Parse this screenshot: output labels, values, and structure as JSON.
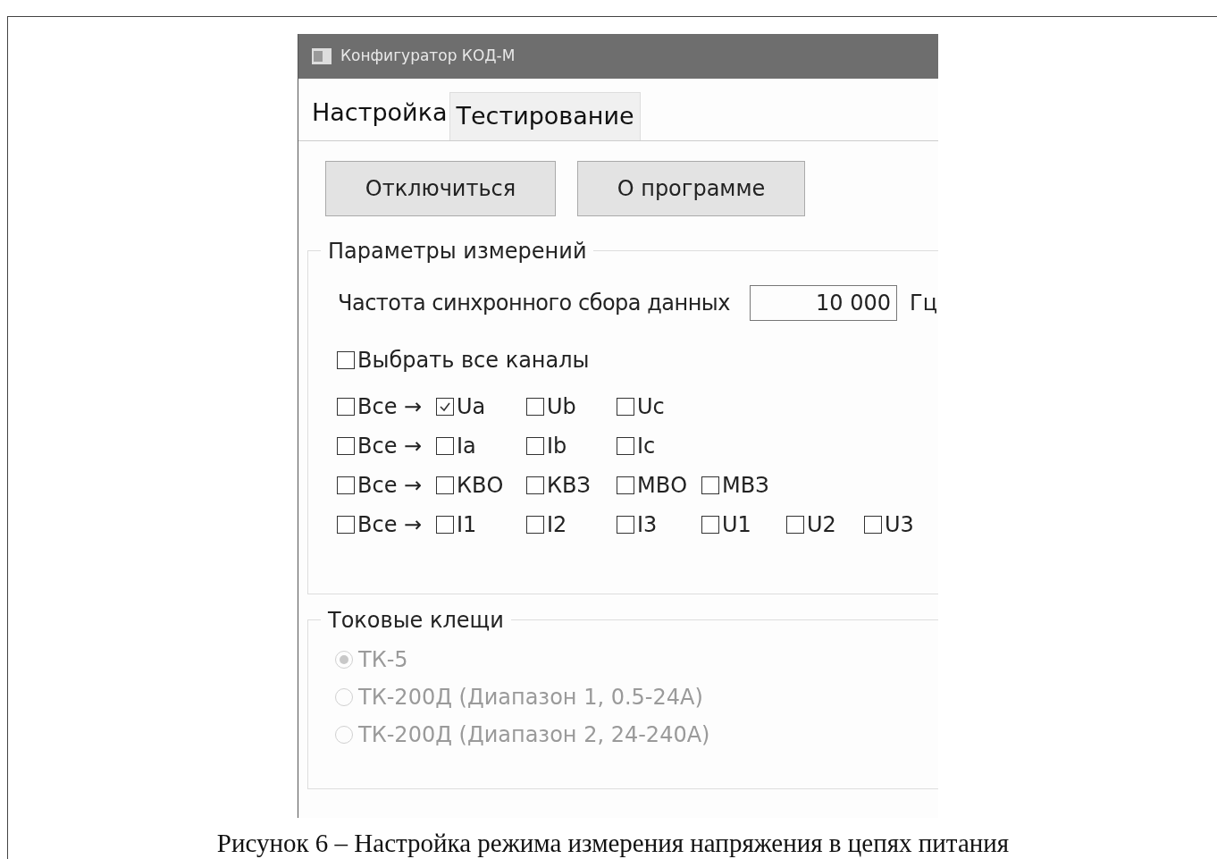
{
  "window": {
    "title": "Конфигуратор КОД-М"
  },
  "tabs": [
    {
      "label": "Настройка",
      "selected": true
    },
    {
      "label": "Тестирование",
      "selected": false
    }
  ],
  "buttons": [
    "Отключиться",
    "О программе"
  ],
  "measurement": {
    "title": "Параметры измерений",
    "frequency_label": "Частота синхронного сбора данных",
    "frequency_value": "10 000",
    "frequency_unit": "Гц",
    "select_all": {
      "label": "Выбрать все каналы",
      "checked": false
    },
    "rows": [
      {
        "all": {
          "label": "Все →",
          "checked": false
        },
        "channels": [
          {
            "label": "Ua",
            "checked": true
          },
          {
            "label": "Ub",
            "checked": false
          },
          {
            "label": "Uc",
            "checked": false
          }
        ]
      },
      {
        "all": {
          "label": "Все →",
          "checked": false
        },
        "channels": [
          {
            "label": "Ia",
            "checked": false
          },
          {
            "label": "Ib",
            "checked": false
          },
          {
            "label": "Ic",
            "checked": false
          }
        ]
      },
      {
        "all": {
          "label": "Все →",
          "checked": false
        },
        "channels": [
          {
            "label": "КВО",
            "checked": false
          },
          {
            "label": "КВЗ",
            "checked": false
          },
          {
            "label": "МВО",
            "checked": false
          },
          {
            "label": "МВЗ",
            "checked": false
          }
        ]
      },
      {
        "all": {
          "label": "Все →",
          "checked": false
        },
        "channels": [
          {
            "label": "I1",
            "checked": false
          },
          {
            "label": "I2",
            "checked": false
          },
          {
            "label": "I3",
            "checked": false
          },
          {
            "label": "U1",
            "checked": false
          },
          {
            "label": "U2",
            "checked": false
          },
          {
            "label": "U3",
            "checked": false
          }
        ]
      }
    ]
  },
  "clamps": {
    "title": "Токовые клещи",
    "options": [
      {
        "label": "ТК-5",
        "selected": true,
        "disabled": true
      },
      {
        "label": "ТК-200Д (Диапазон 1, 0.5-24А)",
        "selected": false,
        "disabled": true
      },
      {
        "label": "ТК-200Д (Диапазон 2, 24-240А)",
        "selected": false,
        "disabled": true
      }
    ]
  },
  "caption": "Рисунок 6 – Настройка режима измерения напряжения в цепях питания"
}
